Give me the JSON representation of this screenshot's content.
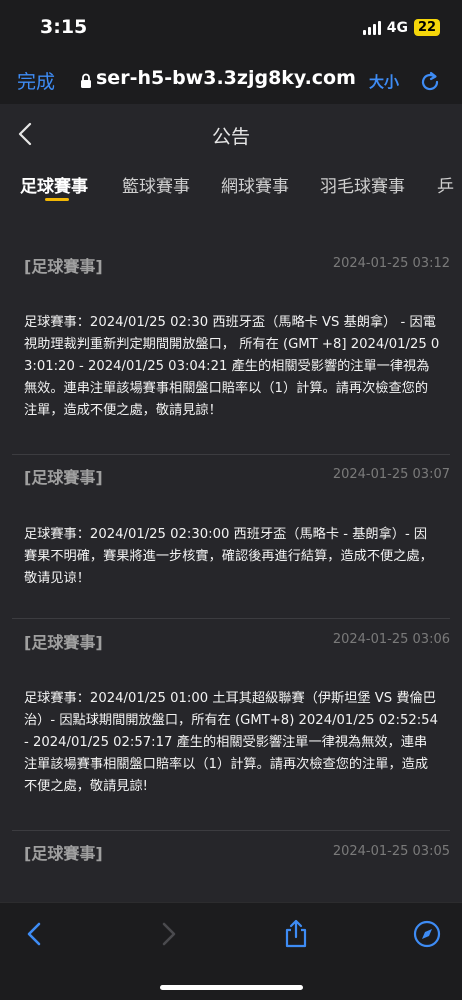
{
  "status_bar": {
    "time": "3:15",
    "network": "4G",
    "battery": "22"
  },
  "browser": {
    "done_label": "完成",
    "url": "ser-h5-bw3.3zjg8ky.com",
    "text_size_label": "大小"
  },
  "header": {
    "title": "公告"
  },
  "tabs": [
    {
      "label": "足球賽事"
    },
    {
      "label": "籃球賽事"
    },
    {
      "label": "網球賽事"
    },
    {
      "label": "羽毛球賽事"
    },
    {
      "label": "乒"
    }
  ],
  "announcements": [
    {
      "tag": "[足球賽事]",
      "date": "2024-01-25 03:12",
      "body": "足球賽事：2024/01/25 02:30 西班牙盃（馬略卡 VS 基朗拿） - 因電視助理裁判重新判定期間開放盤口， 所有在 (GMT +8] 2024/01/25 03:01:20 - 2024/01/25 03:04:21 產生的相關受影響的注單一律視為無效。連串注單該場賽事相關盤口賠率以（1）計算。請再次檢查您的注單，造成不便之處，敬請見諒！"
    },
    {
      "tag": "[足球賽事]",
      "date": "2024-01-25 03:07",
      "body": "足球賽事：2024/01/25 02:30:00 西班牙盃（馬略卡 - 基朗拿）- 因賽果不明確，賽果將進一步核實，確認後再進行結算，造成不便之處，敬请见谅！"
    },
    {
      "tag": "[足球賽事]",
      "date": "2024-01-25 03:06",
      "body": "足球賽事：2024/01/25 01:00 土耳其超級聯賽（伊斯坦堡 VS 費倫巴治）- 因點球期間開放盤口，所有在 (GMT+8) 2024/01/25 02:52:54 - 2024/01/25 02:57:17 產生的相關受影響注單一律視為無效，連串注單該場賽事相關盤口賠率以（1）計算。請再次檢查您的注單，造成不便之處，敬請見諒!"
    },
    {
      "tag": "[足球賽事]",
      "date": "2024-01-25 03:05",
      "body": ""
    }
  ],
  "colors": {
    "accent_blue": "#3e8cf5",
    "tab_indicator": "#f2b705",
    "battery": "#f5d60a"
  },
  "icons": {
    "back": "chevron-left-icon",
    "forward": "chevron-right-icon",
    "share": "share-icon",
    "compass": "compass-icon",
    "reload": "reload-icon",
    "lock": "lock-icon"
  }
}
